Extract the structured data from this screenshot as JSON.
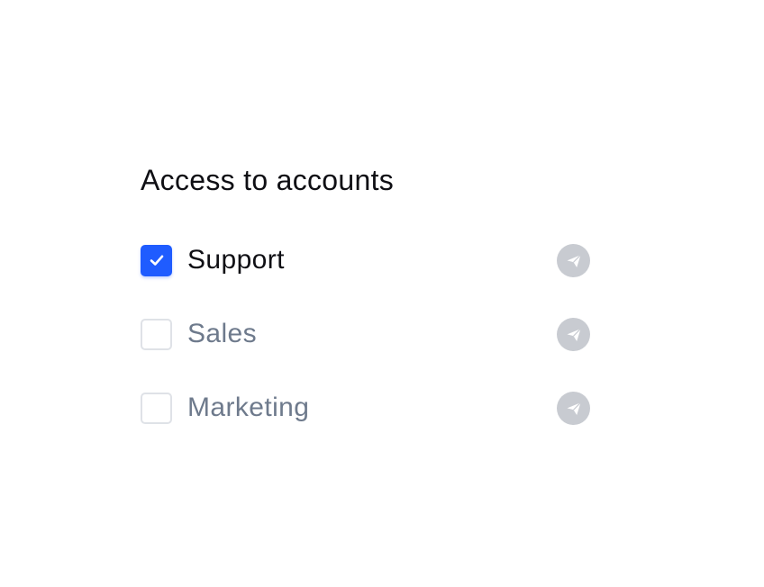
{
  "title": "Access to accounts",
  "accounts": [
    {
      "label": "Support",
      "checked": true,
      "action_icon": "send-icon"
    },
    {
      "label": "Sales",
      "checked": false,
      "action_icon": "send-icon"
    },
    {
      "label": "Marketing",
      "checked": false,
      "action_icon": "send-icon"
    }
  ],
  "colors": {
    "accent": "#1f5cff",
    "checkbox_border": "#dfe2e7",
    "label_active": "#0f0f14",
    "label_inactive": "#6e7a8c",
    "icon_bg": "#c8cbd1"
  }
}
